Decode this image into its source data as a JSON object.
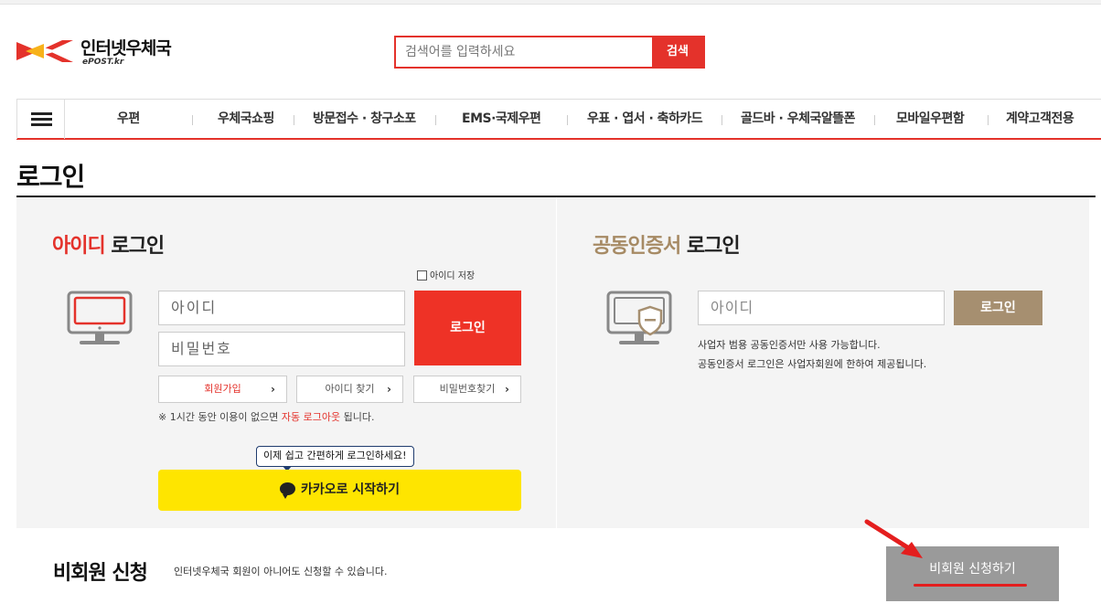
{
  "header": {
    "logo_title": "인터넷우체국",
    "logo_sub": "ePOST.kr",
    "search_placeholder": "검색어를 입력하세요",
    "search_button": "검색"
  },
  "nav": {
    "items": [
      "우편",
      "우체국쇼핑",
      "방문접수 · 창구소포",
      "EMS·국제우편",
      "우표 · 엽서 · 축하카드",
      "골드바 · 우체국알뜰폰",
      "모바일우편함",
      "계약고객전용"
    ]
  },
  "page": {
    "title": "로그인"
  },
  "id_login": {
    "heading_accent": "아이디",
    "heading_rest": " 로그인",
    "save_id": "아이디 저장",
    "id_placeholder": "아이디",
    "pw_placeholder": "비밀번호",
    "login_button": "로그인",
    "signup": "회원가입",
    "find_id": "아이디 찾기",
    "find_pw": "비밀번호찾기",
    "notice_prefix": "※ 1시간 동안 이용이 없으면 ",
    "notice_highlight": "자동 로그아웃",
    "notice_suffix": " 됩니다.",
    "kakao_tooltip": "이제 쉽고 간편하게 로그인하세요!",
    "kakao_button": "카카오로 시작하기"
  },
  "cert_login": {
    "heading_accent": "공동인증서",
    "heading_rest": " 로그인",
    "id_placeholder": "아이디",
    "login_button": "로그인",
    "note1": "사업자 범용 공동인증서만 사용 가능합니다.",
    "note2": "공동인증서 로그인은 사업자회원에 한하여 제공됩니다."
  },
  "guest": {
    "title": "비회원 신청",
    "description": "인터넷우체국 회원이 아니어도 신청할 수 있습니다.",
    "button": "비회원 신청하기"
  },
  "colors": {
    "accent_red": "#e4322b",
    "cert_brown": "#a68f70",
    "kakao_yellow": "#fee500",
    "guest_gray": "#9a9a9a"
  }
}
